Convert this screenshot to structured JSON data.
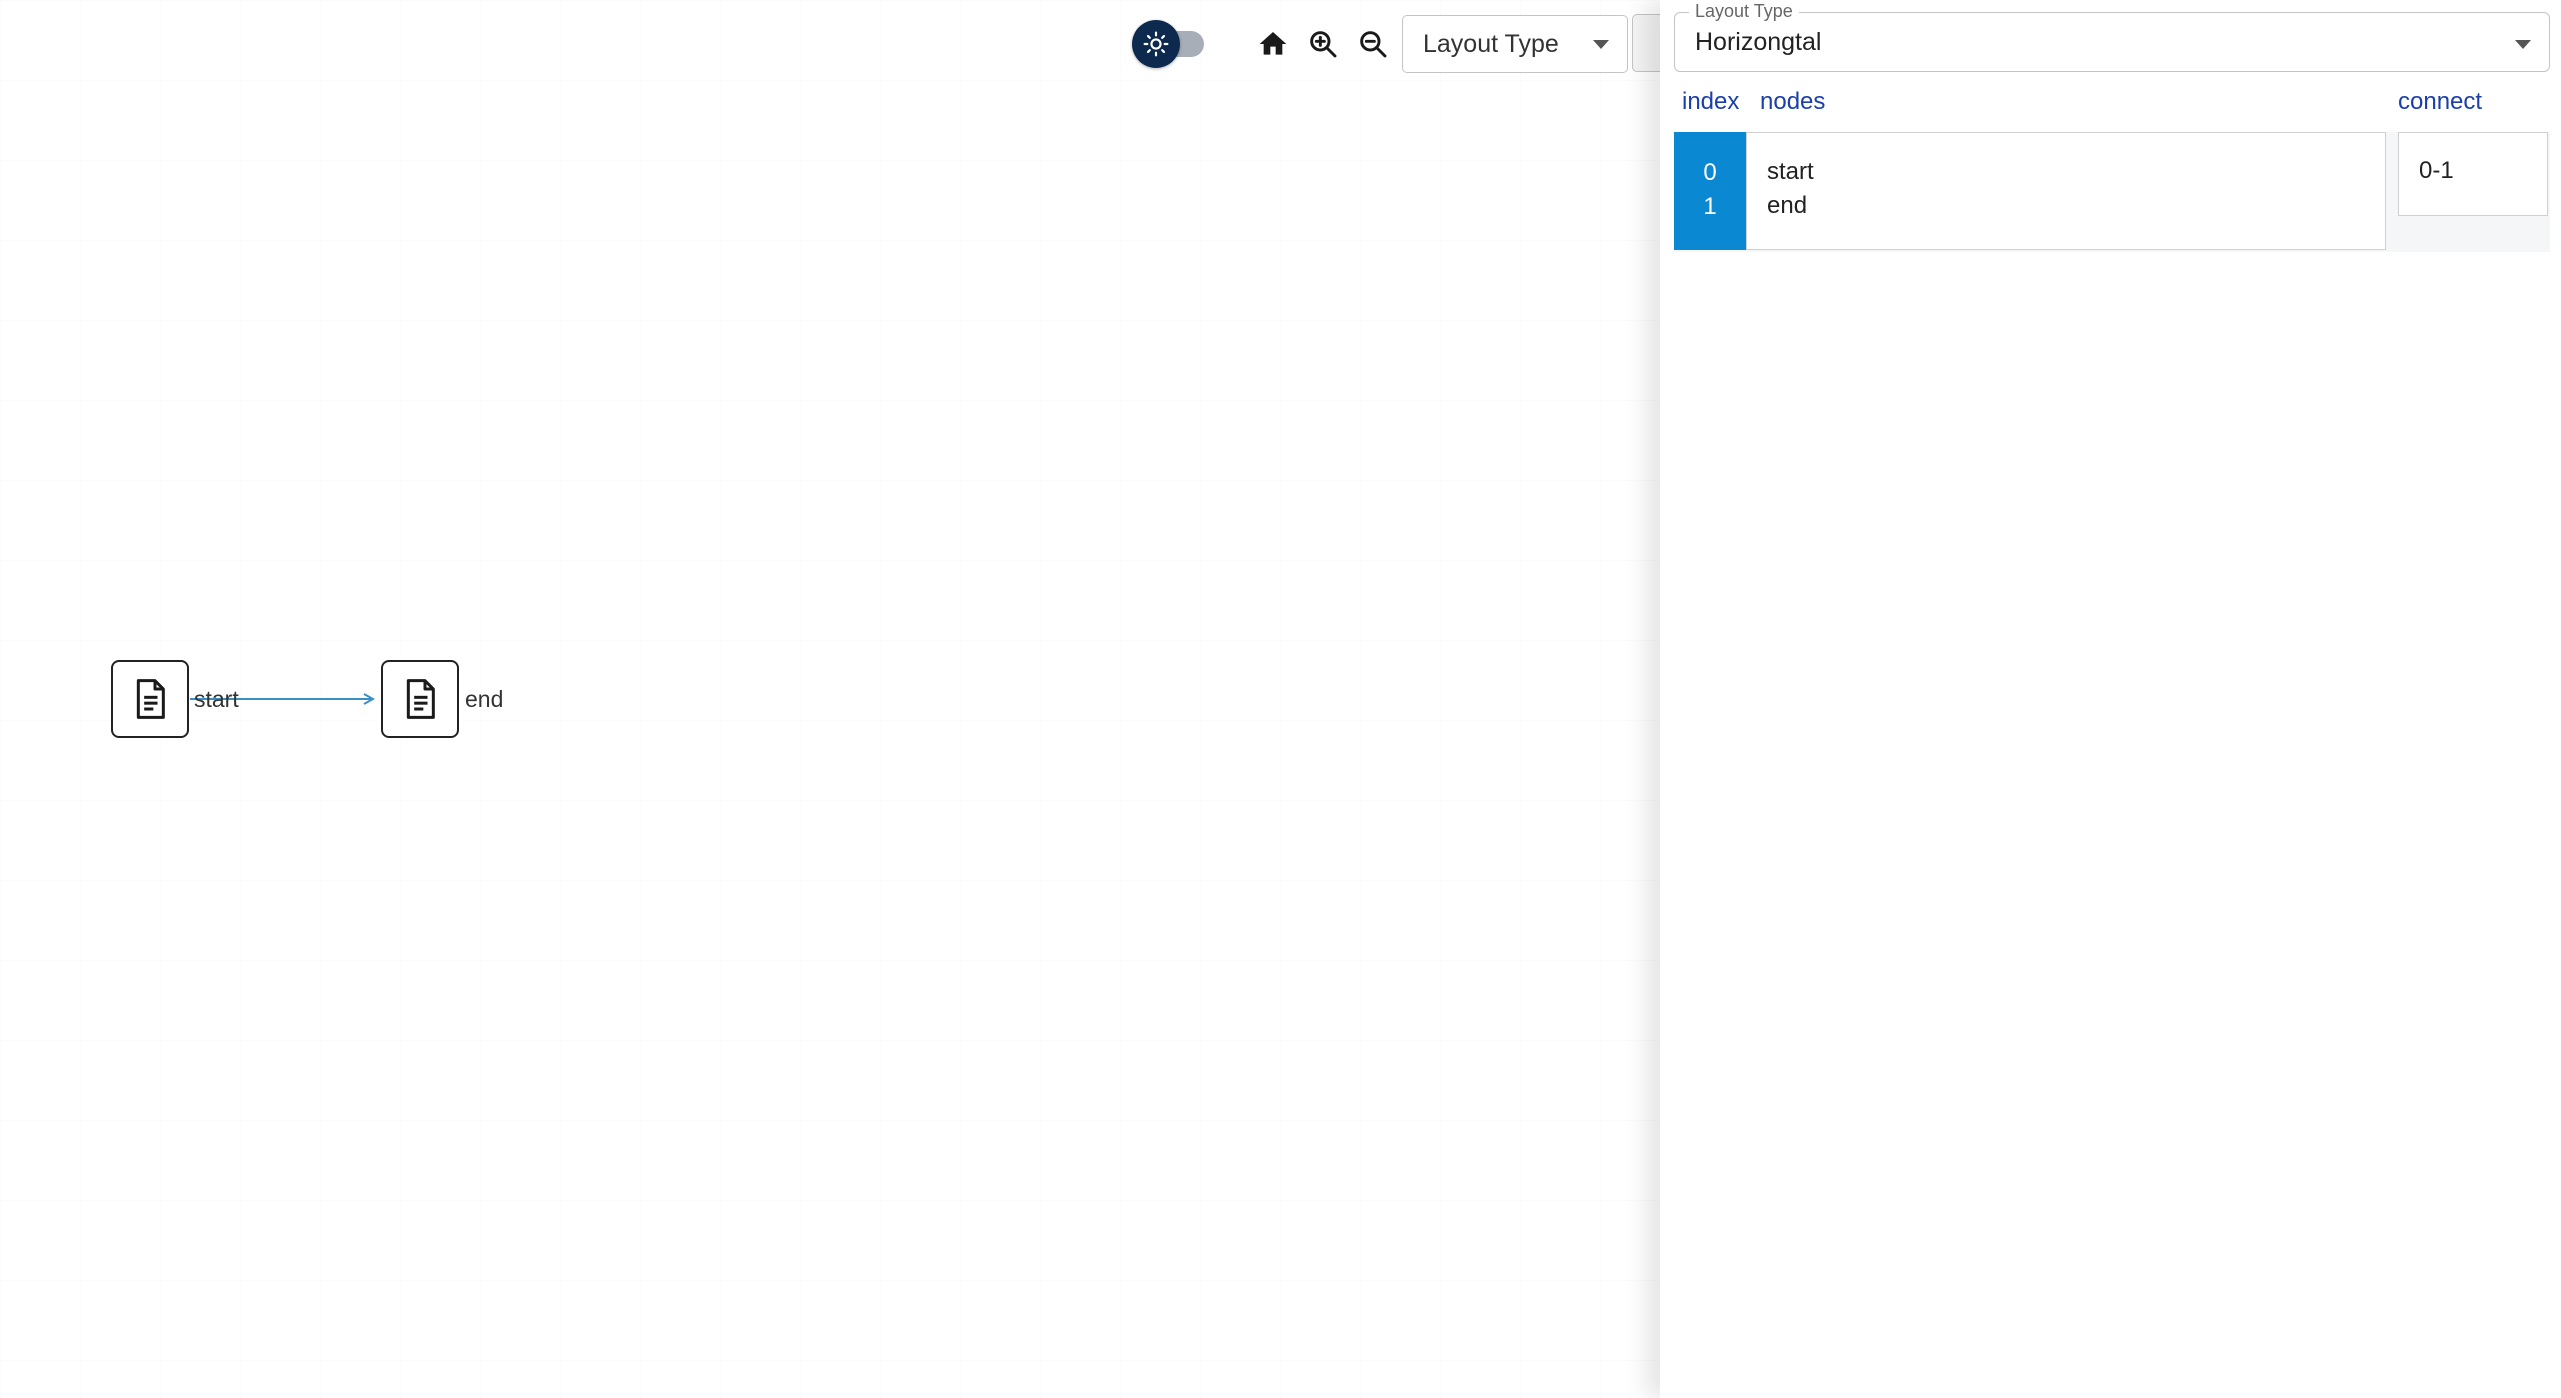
{
  "toolbar": {
    "theme_toggle": {
      "state": "light",
      "icon": "sun-icon"
    },
    "home_icon": "home-icon",
    "zoom_in_icon": "zoom-in-icon",
    "zoom_out_icon": "zoom-out-icon",
    "layout_type_button": {
      "label": "Layout Type"
    }
  },
  "graph": {
    "nodes": [
      {
        "id": 0,
        "label": "start",
        "icon": "document-icon"
      },
      {
        "id": 1,
        "label": "end",
        "icon": "document-icon"
      }
    ],
    "edges": [
      {
        "from": 0,
        "to": 1
      }
    ],
    "edge_color": "#3a8fc4"
  },
  "panel": {
    "layout_field": {
      "legend": "Layout Type",
      "value": "Horizongtal"
    },
    "headers": {
      "index": "index",
      "nodes": "nodes",
      "connect": "connect"
    },
    "rows": {
      "indices": [
        "0",
        "1"
      ],
      "nodes": [
        "start",
        "end"
      ],
      "connect": "0-1"
    }
  },
  "colors": {
    "accent": "#0a88d2",
    "header_text": "#1a3faa",
    "toggle_thumb": "#0d2a4e"
  }
}
